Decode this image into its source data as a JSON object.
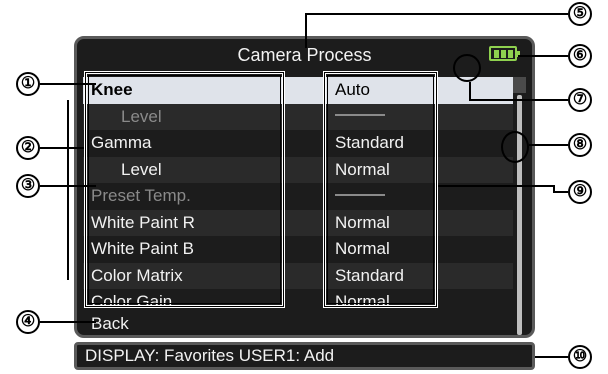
{
  "screen": {
    "title": "Camera Process",
    "battery_color": "#8fd14f"
  },
  "menu": {
    "items": [
      {
        "label": "Knee",
        "value": "Auto",
        "state": "selected"
      },
      {
        "label": "Level",
        "value": "",
        "state": "disabled",
        "indent": true
      },
      {
        "label": "Gamma",
        "value": "Standard",
        "state": "normal"
      },
      {
        "label": "Level",
        "value": "Normal",
        "state": "normal",
        "indent": true
      },
      {
        "label": "Preset Temp.",
        "value": "",
        "state": "disabled"
      },
      {
        "label": "White Paint R",
        "value": "Normal",
        "state": "normal"
      },
      {
        "label": "White Paint B",
        "value": "Normal",
        "state": "normal"
      },
      {
        "label": "Color Matrix",
        "value": "Standard",
        "state": "normal"
      },
      {
        "label": "Color Gain",
        "value": "Normal",
        "state": "normal"
      }
    ],
    "back_label": "Back"
  },
  "statusbar": {
    "text": "DISPLAY: Favorites  USER1: Add"
  },
  "callouts": [
    "①",
    "②",
    "③",
    "④",
    "⑤",
    "⑥",
    "⑦",
    "⑧",
    "⑨",
    "⑩"
  ]
}
